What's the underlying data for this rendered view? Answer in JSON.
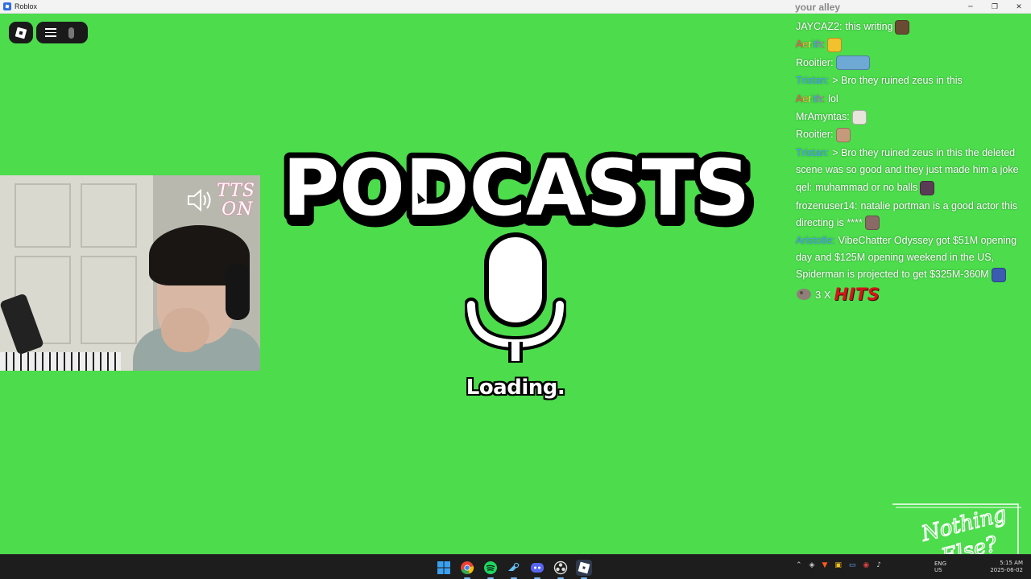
{
  "window": {
    "title": "Roblox",
    "controls": {
      "minimize": "─",
      "restore": "❐",
      "close": "✕"
    }
  },
  "game": {
    "heading": "PODCASTS",
    "loading_text": "Loading.",
    "background_color": "#4cdc4c"
  },
  "webcam": {
    "tts_label_line1": "TTS",
    "tts_label_line2": "ON"
  },
  "chat": {
    "header": "your alley",
    "messages": [
      {
        "user": "JAYCAZ2:",
        "user_color": "#ffffff",
        "text": "this writing",
        "emote": "smiling-man-emote"
      },
      {
        "user": "Aerith:",
        "user_color": "rainbow",
        "text": "",
        "emote": "laughing-emote"
      },
      {
        "user": "Rooitier:",
        "user_color": "#ffffff",
        "text": "",
        "emote": "sleeping-face-emote"
      },
      {
        "user": "Tristan:",
        "user_color": "#4aa3ff",
        "text": "> Bro they ruined zeus in this",
        "emote": ""
      },
      {
        "user": "Aerith:",
        "user_color": "rainbow",
        "text": "lol",
        "emote": ""
      },
      {
        "user": "MrAmyntas:",
        "user_color": "#ffffff",
        "text": "",
        "emote": "sunglasses-emote"
      },
      {
        "user": "Rooitier:",
        "user_color": "#ffffff",
        "text": "",
        "emote": "head-emote"
      },
      {
        "user": "Tristan:",
        "user_color": "#4aa3ff",
        "text": "> Bro they ruined zeus in this the deleted scene was so good and they just made him a joke",
        "emote": ""
      },
      {
        "user": "qel:",
        "user_color": "#ffffff",
        "text": "muhammad or no balls",
        "emote": "cap-emote"
      },
      {
        "user": "frozenuser14:",
        "user_color": "#ffffff",
        "text": "natalie portman is a good actor this directing is ****",
        "emote": "face-emote"
      },
      {
        "user": "Aristotle:",
        "user_color": "#4aa3ff",
        "text": "VibeChatter Odyssey got $51M opening day and $125M opening weekend in the US, Spiderman is projected to get $325M-360M",
        "emote": "spiderman-emote"
      }
    ],
    "hits": {
      "count": "3 X",
      "label": "HITS"
    }
  },
  "watermark": {
    "line1": "Nothing",
    "line2": "Else?"
  },
  "taskbar": {
    "apps": [
      "windows-start-icon",
      "chrome-icon",
      "spotify-icon",
      "steam-icon",
      "discord-icon",
      "obs-icon",
      "roblox-icon"
    ],
    "lang_line1": "ENG",
    "lang_line2": "US",
    "time": "5:15 AM",
    "date": "2025-06-02"
  }
}
